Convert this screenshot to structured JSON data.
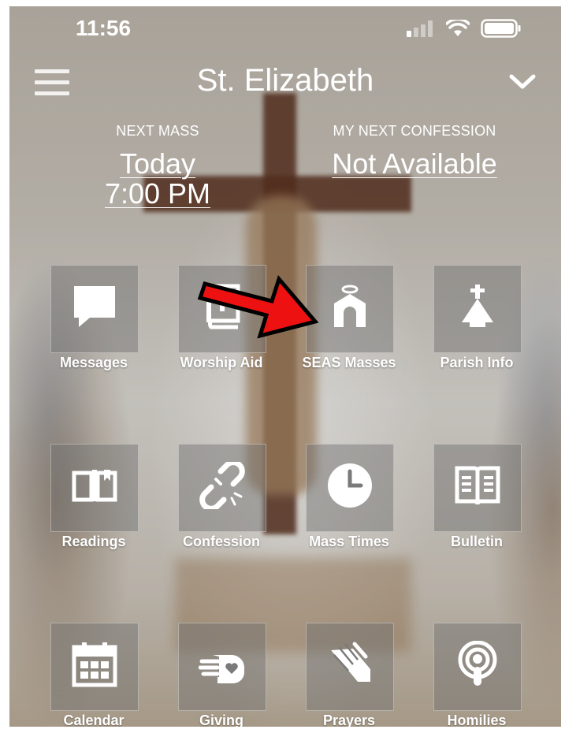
{
  "status_bar": {
    "time": "11:56"
  },
  "header": {
    "title": "St. Elizabeth"
  },
  "next_mass": {
    "label": "NEXT MASS",
    "day": "Today",
    "time": "7:00 PM"
  },
  "next_confession": {
    "label": "MY NEXT CONFESSION",
    "value": "Not Available"
  },
  "tiles": [
    {
      "label": "Messages",
      "icon": "chat-bubble-icon"
    },
    {
      "label": "Worship Aid",
      "icon": "book-icon"
    },
    {
      "label": "SEAS Masses",
      "icon": "church-icon"
    },
    {
      "label": "Parish Info",
      "icon": "parish-church-icon"
    },
    {
      "label": "Readings",
      "icon": "open-book-icon"
    },
    {
      "label": "Confession",
      "icon": "broken-chain-icon"
    },
    {
      "label": "Mass Times",
      "icon": "clock-icon"
    },
    {
      "label": "Bulletin",
      "icon": "newspaper-icon"
    },
    {
      "label": "Calendar",
      "icon": "calendar-icon"
    },
    {
      "label": "Giving",
      "icon": "giving-hand-icon"
    },
    {
      "label": "Prayers",
      "icon": "praying-hands-icon"
    },
    {
      "label": "Homilies",
      "icon": "podcast-icon"
    }
  ],
  "colors": {
    "arrow": "#ee1111",
    "tile_bg": "rgba(110,110,110,0.45)"
  }
}
